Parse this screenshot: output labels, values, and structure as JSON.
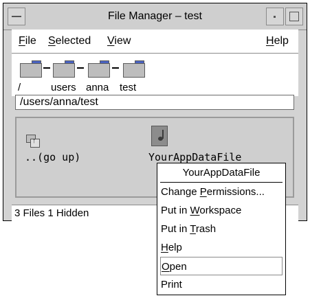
{
  "window": {
    "title": "File Manager – test"
  },
  "menubar": {
    "file": {
      "pre": "",
      "mn": "F",
      "post": "ile"
    },
    "selected": {
      "pre": "",
      "mn": "S",
      "post": "elected"
    },
    "view": {
      "pre": "",
      "mn": "V",
      "post": "iew"
    },
    "help": {
      "pre": "",
      "mn": "H",
      "post": "elp"
    }
  },
  "path_components": [
    "/",
    "users",
    "anna",
    "test"
  ],
  "path_field": {
    "value": "/users/anna/test"
  },
  "files": [
    {
      "name": "..(go up)",
      "icon": "folder-up-icon"
    },
    {
      "name": "YourAppDataFile",
      "icon": "music-file-icon"
    }
  ],
  "status": {
    "text": "3 Files 1 Hidden"
  },
  "popup_menu": {
    "title": "YourAppDataFile",
    "items": [
      {
        "pre": "Change ",
        "mn": "P",
        "post": "ermissions..."
      },
      {
        "pre": "Put in ",
        "mn": "W",
        "post": "orkspace"
      },
      {
        "pre": "Put in ",
        "mn": "T",
        "post": "rash"
      },
      {
        "pre": "",
        "mn": "H",
        "post": "elp"
      },
      {
        "pre": "",
        "mn": "O",
        "post": "pen"
      },
      {
        "pre": "Print",
        "mn": "",
        "post": ""
      }
    ],
    "selected_index": 4
  }
}
